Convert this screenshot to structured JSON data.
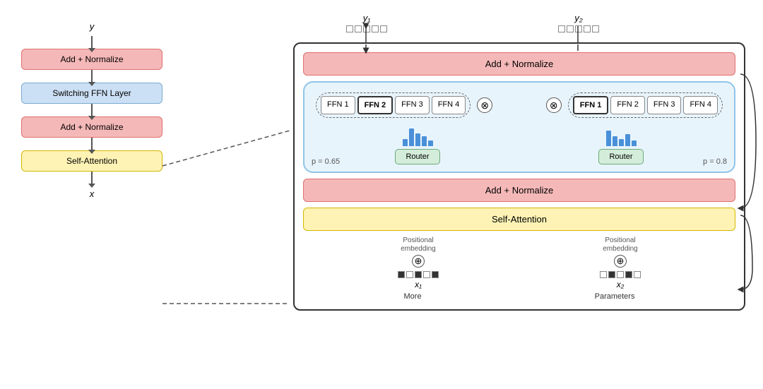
{
  "left": {
    "y_label": "y",
    "x_label": "x",
    "add_normalize_top": "Add + Normalize",
    "switching_ffn": "Switching FFN Layer",
    "add_normalize_bottom": "Add + Normalize",
    "self_attention": "Self-Attention"
  },
  "right": {
    "title_top_norm": "Add + Normalize",
    "title_bottom_norm": "Add + Normalize",
    "self_attention": "Self-Attention",
    "router_label": "Router",
    "p_left": "p = 0.65",
    "p_right": "p = 0.8",
    "ffn_groups": [
      [
        "FFN 1",
        "FFN 2",
        "FFN 3",
        "FFN 4"
      ],
      [
        "FFN 1",
        "FFN 2",
        "FFN 3",
        "FFN 4"
      ]
    ],
    "bold_ffn_left": "FFN 2",
    "bold_ffn_right": "FFN 1",
    "y1_label": "y₁",
    "y2_label": "y₂",
    "x1_label": "x₁",
    "x2_label": "x₂",
    "pos_embed": "Positional\nembedding",
    "more_label": "More",
    "params_label": "Parameters"
  }
}
